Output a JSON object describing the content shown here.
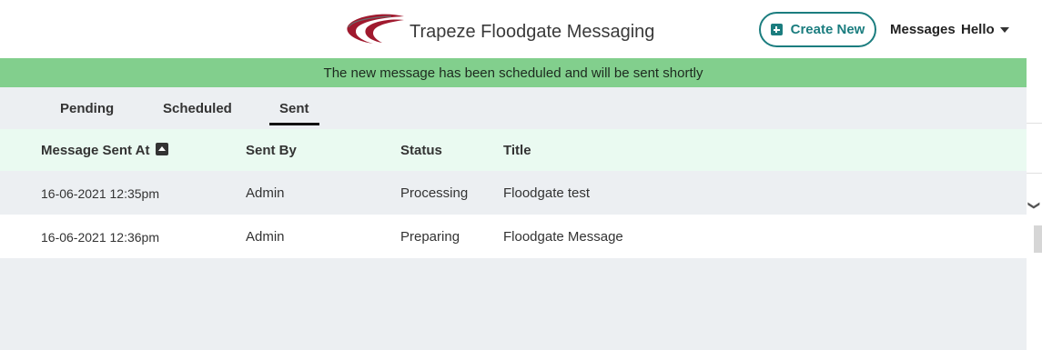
{
  "header": {
    "brand_title": "Trapeze Floodgate Messaging",
    "create_label": "Create New",
    "messages_label": "Messages",
    "user_label": "Hello"
  },
  "banner": {
    "text": "The new message has been scheduled and will be sent shortly",
    "color": "#82cf8d"
  },
  "tabs": [
    {
      "label": "Pending",
      "active": false
    },
    {
      "label": "Scheduled",
      "active": false
    },
    {
      "label": "Sent",
      "active": true
    }
  ],
  "table": {
    "columns": [
      "Message Sent At",
      "Sent By",
      "Status",
      "Title"
    ],
    "sort_column": "Message Sent At",
    "rows": [
      [
        "16-06-2021 12:35pm",
        "Admin",
        "Processing",
        "Floodgate test"
      ],
      [
        "16-06-2021 12:36pm",
        "Admin",
        "Preparing",
        "Floodgate Message"
      ]
    ]
  },
  "colors": {
    "accent": "#1b7d7f",
    "logo": "#a0192e",
    "header_row_bg": "#eafaf1"
  },
  "icons": {
    "logo": "trapeze-logo",
    "create": "plus-square-icon",
    "user_menu": "caret-down-icon",
    "sort": "sort-up-icon",
    "scroll": "chevron-right-icon"
  }
}
